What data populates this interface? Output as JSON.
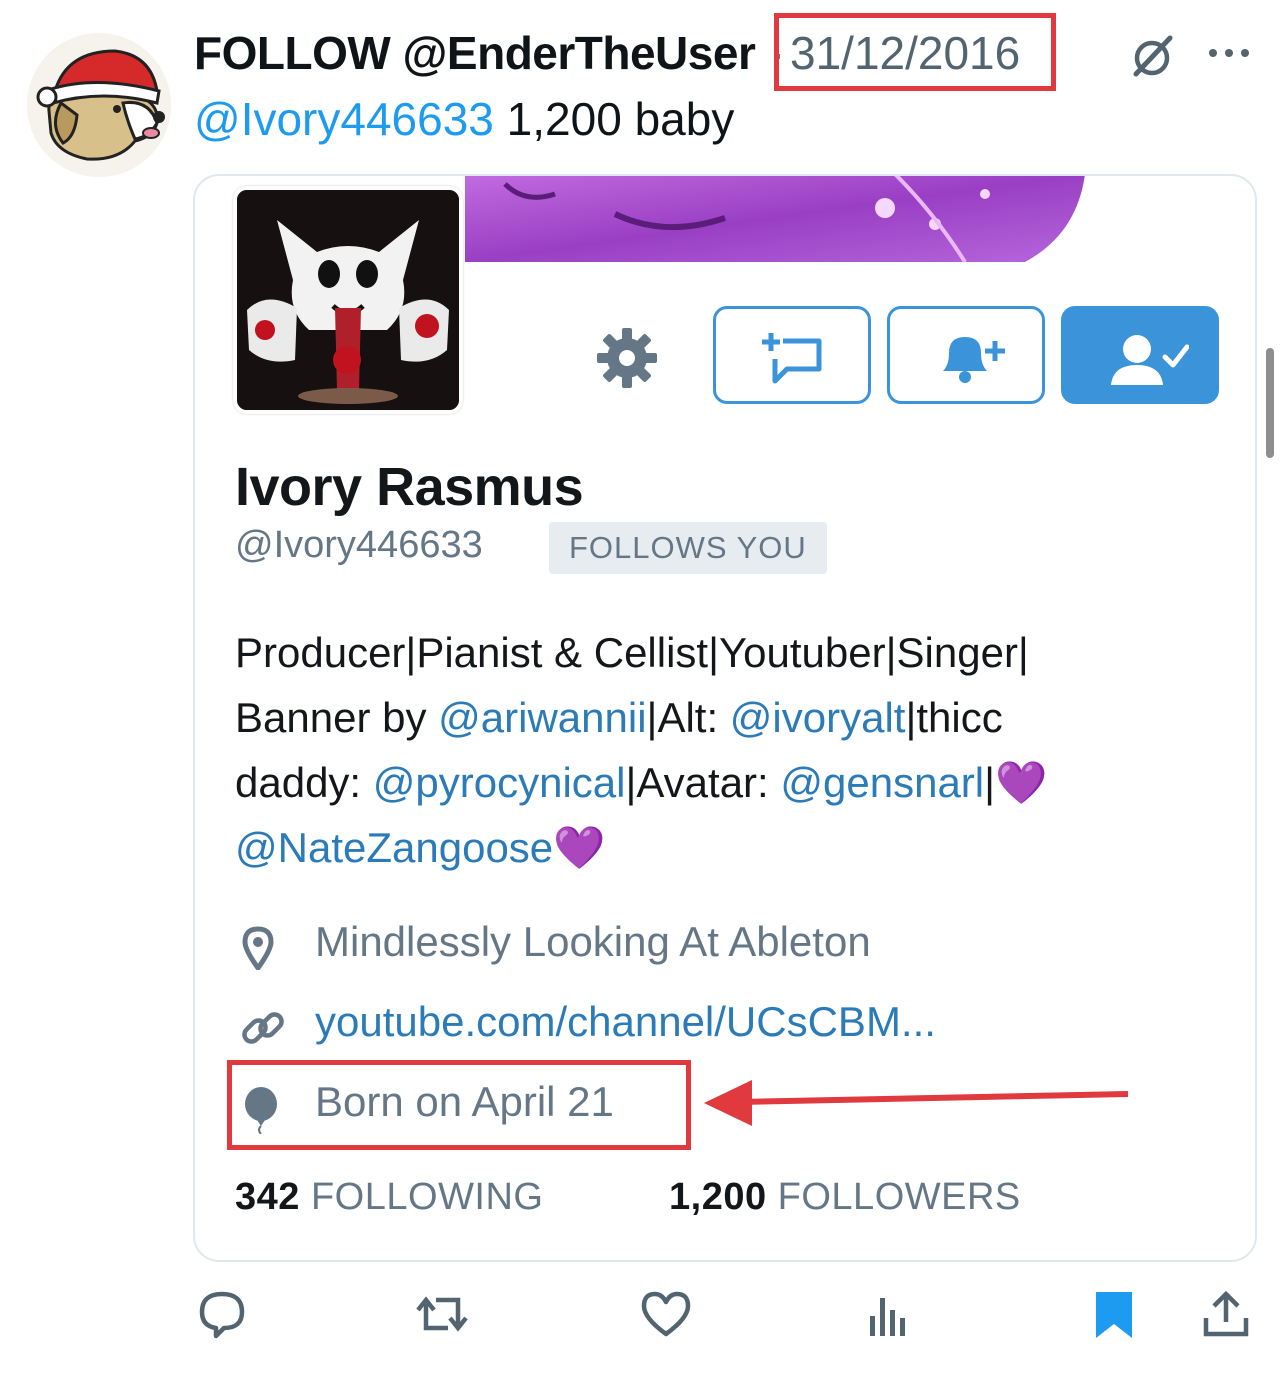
{
  "tweet": {
    "author": "FOLLOW @EnderTheUser",
    "separator": "·",
    "date": "31/12/2016",
    "reply_mention": "@Ivory446633",
    "reply_text": " 1,200 baby"
  },
  "embedded_profile": {
    "name": "Ivory Rasmus",
    "handle": "@Ivory446633",
    "follows_you_badge": "FOLLOWS YOU",
    "bio": {
      "line1": "Producer|Pianist & Cellist|Youtuber|Singer|",
      "line2_prefix": "Banner by ",
      "line2_link1": "@ariwannii",
      "line2_mid": "|Alt: ",
      "line2_link2": "@ivoryalt",
      "line2_suffix": "|thicc",
      "line3_prefix": "daddy: ",
      "line3_link1": "@pyrocynical",
      "line3_mid": "|Avatar: ",
      "line3_link2": "@gensnarl",
      "line3_suffix": "|",
      "line4_link": "@NateZangoose",
      "heart": "💜"
    },
    "location": "Mindlessly Looking At Ableton",
    "url": "youtube.com/channel/UCsCBM...",
    "birthday": "Born on April 21",
    "following_count": "342",
    "following_label": "FOLLOWING",
    "followers_count": "1,200",
    "followers_label": "FOLLOWERS"
  },
  "icons": {
    "header": [
      "grok-icon",
      "more-icon"
    ],
    "profile_buttons": [
      "gear-icon",
      "direct-message-icon",
      "notification-bell-icon",
      "following-icon"
    ],
    "meta": [
      "location-pin-icon",
      "link-icon",
      "balloon-icon"
    ],
    "actions": [
      "reply-icon",
      "retweet-icon",
      "like-icon",
      "views-icon",
      "bookmark-icon",
      "share-icon"
    ]
  },
  "colors": {
    "link_blue": "#1d9bf0",
    "profile_blue": "#3b94d9",
    "highlight_red": "#e0393e",
    "heart_purple": "#9b40d8"
  }
}
